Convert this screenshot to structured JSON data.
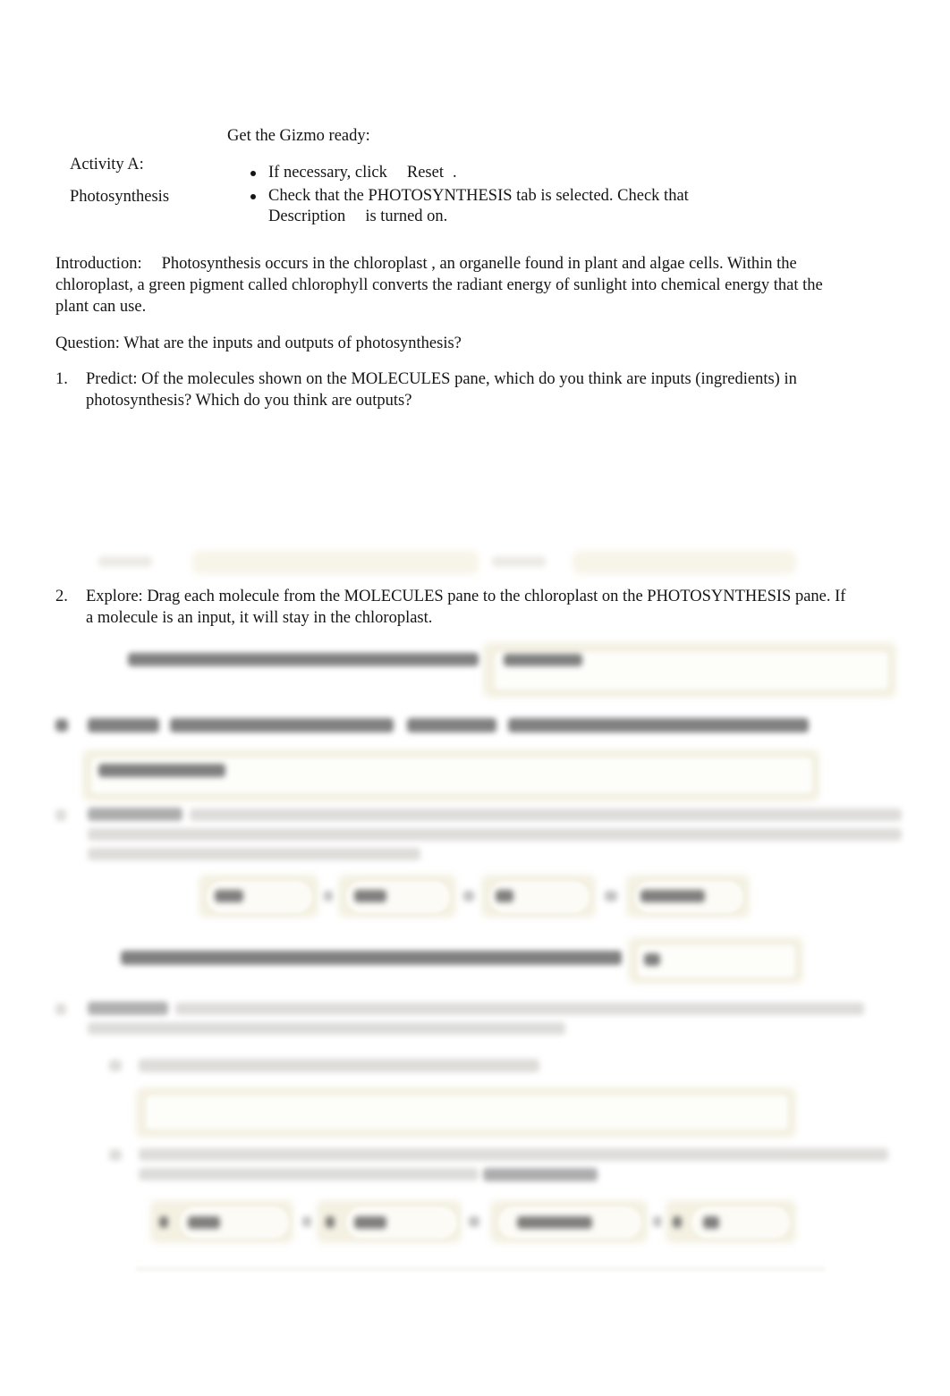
{
  "document": {
    "title": "Activity A: Photosynthesis",
    "activity": {
      "label_line1": "Activity A:",
      "label_line2": "Photosynthesis",
      "ready_heading": "Get the Gizmo ready:",
      "bullets": [
        "If necessary, click   Reset  .",
        "Check that the PHOTOSYNTHESIS tab is selected. Check that Description    is turned on."
      ],
      "bullet1_prefix": "If necessary, click",
      "bullet1_button": "Reset",
      "bullet1_suffix": ".",
      "bullet2_line1_a": "Check that the PHOTOSYNTHESIS tab is selected. Check that",
      "bullet2_line2_a": "Description",
      "bullet2_line2_b": "is turned on."
    },
    "introduction": {
      "label": "Introduction:",
      "text": "Photosynthesis occurs in the      chloroplast   , an organelle found in plant and algae cells. Within the chloroplast, a green pigment called       chlorophyll    converts the   radiant energy     of sunlight into   chemical energy    that the plant can use."
    },
    "question": "Question: What are the inputs and outputs of photosynthesis?",
    "items": [
      {
        "number": "1.",
        "text": "Predict: Of the molecules shown on the MOLECULES pane, which do you think are inputs (ingredients) in photosynthesis? Which do you think are outputs?"
      },
      {
        "number": "2.",
        "text": "Explore: Drag each molecule from the MOLECULES pane to the chloroplast on the PHOTOSYNTHESIS pane. If a molecule is an input, it will stay in the chloroplast."
      }
    ],
    "redacted_region": {
      "note": "Lower portion of the page is blurred/illegible",
      "visible_structures": [
        "answer-box",
        "equation-row",
        "equation-row",
        "answer-box",
        "footer-rule"
      ]
    }
  }
}
